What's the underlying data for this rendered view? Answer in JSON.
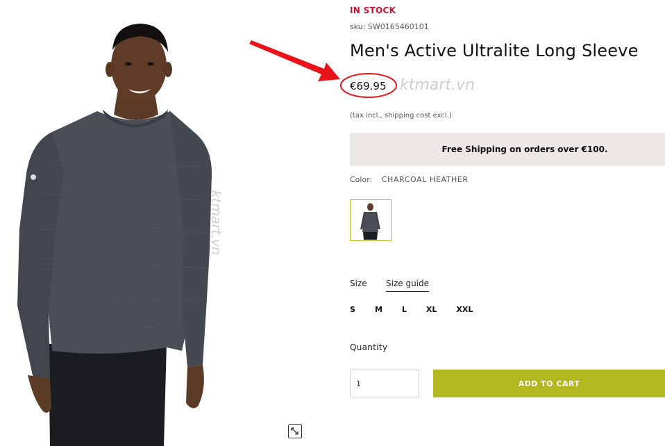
{
  "product": {
    "stock_status": "IN STOCK",
    "sku": "sku: SW0165460101",
    "title": "Men's Active Ultralite Long Sleeve",
    "price": "€69.95",
    "tax_note": "(tax incl., shipping cost excl.)"
  },
  "banner": {
    "text": "Free Shipping on orders over €100."
  },
  "color": {
    "label": "Color:",
    "value": "CHARCOAL HEATHER"
  },
  "size": {
    "label": "Size",
    "guide_label": "Size guide",
    "options": [
      "S",
      "M",
      "L",
      "XL",
      "XXL"
    ]
  },
  "quantity": {
    "label": "Quantity",
    "value": "1"
  },
  "cart": {
    "button_label": "ADD TO CART"
  },
  "watermarks": {
    "text": "ktmart.vn"
  },
  "colors": {
    "stock_red": "#c8102e",
    "accent_olive": "#b2b81f",
    "banner_bg": "#ebe8e5",
    "annotation_red": "#e8141a"
  },
  "icons": {
    "expand": "expand-diagonal-icon"
  }
}
